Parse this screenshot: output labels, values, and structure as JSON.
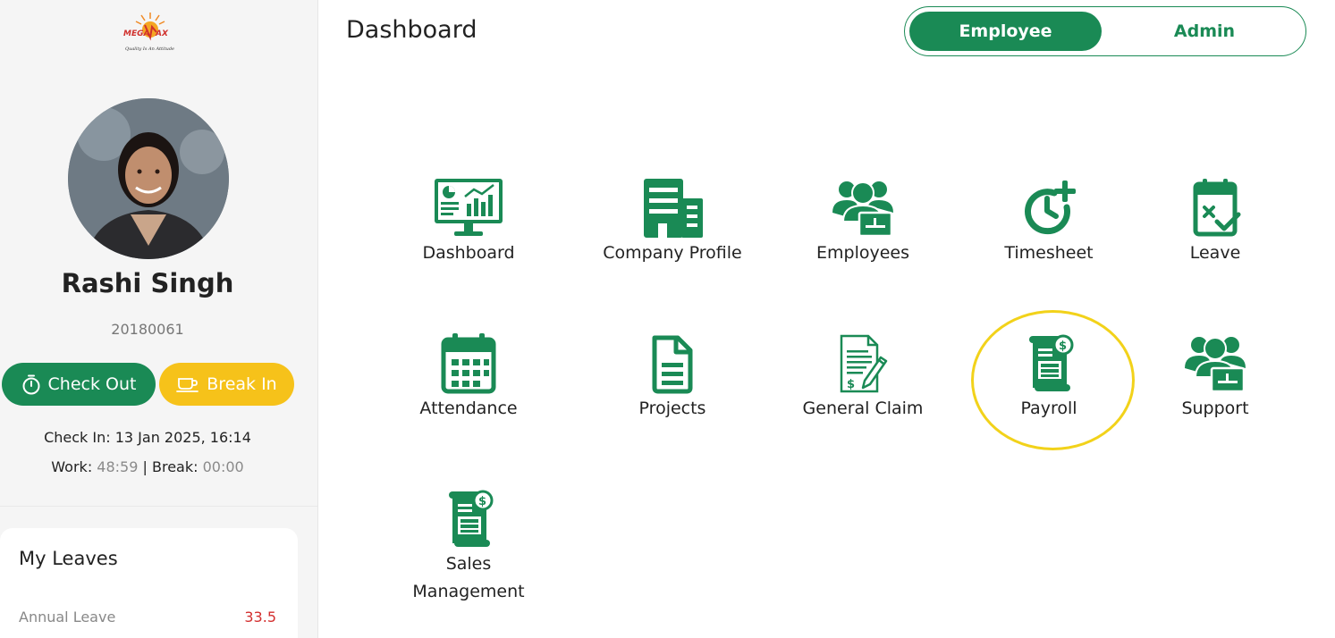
{
  "brand": {
    "logo_text": "MEGAMAX",
    "tagline": "Quality Is An Attitude"
  },
  "user": {
    "name": "Rashi Singh",
    "id": "20180061"
  },
  "actions": {
    "checkout_label": "Check Out",
    "break_label": "Break In"
  },
  "attendance": {
    "check_in_label": "Check In:",
    "check_in_value": "13 Jan 2025, 16:14",
    "work_label": "Work:",
    "work_value": "48:59",
    "separator": "|",
    "break_label": "Break:",
    "break_value": "00:00"
  },
  "leaves": {
    "title": "My Leaves",
    "items": [
      {
        "name": "Annual Leave",
        "value": "33.5"
      }
    ]
  },
  "header": {
    "title": "Dashboard",
    "toggle": {
      "employee": "Employee",
      "admin": "Admin",
      "selected": "Employee"
    }
  },
  "tiles": [
    {
      "label": "Dashboard",
      "icon": "monitor-chart-icon"
    },
    {
      "label": "Company Profile",
      "icon": "building-icon"
    },
    {
      "label": "Employees",
      "icon": "people-group-icon"
    },
    {
      "label": "Timesheet",
      "icon": "clock-plus-icon"
    },
    {
      "label": "Leave",
      "icon": "calendar-check-icon"
    },
    {
      "label": "Attendance",
      "icon": "calendar-grid-icon"
    },
    {
      "label": "Projects",
      "icon": "document-icon"
    },
    {
      "label": "General Claim",
      "icon": "claim-form-icon"
    },
    {
      "label": "Payroll",
      "icon": "payroll-scroll-icon"
    },
    {
      "label": "Support",
      "icon": "support-group-icon"
    },
    {
      "label": "Sales Management",
      "icon": "sales-scroll-icon"
    }
  ],
  "colors": {
    "primary": "#1a8a55",
    "accent": "#f6c21a",
    "highlight": "#f2d21a",
    "leave_value": "#d32f2f"
  }
}
